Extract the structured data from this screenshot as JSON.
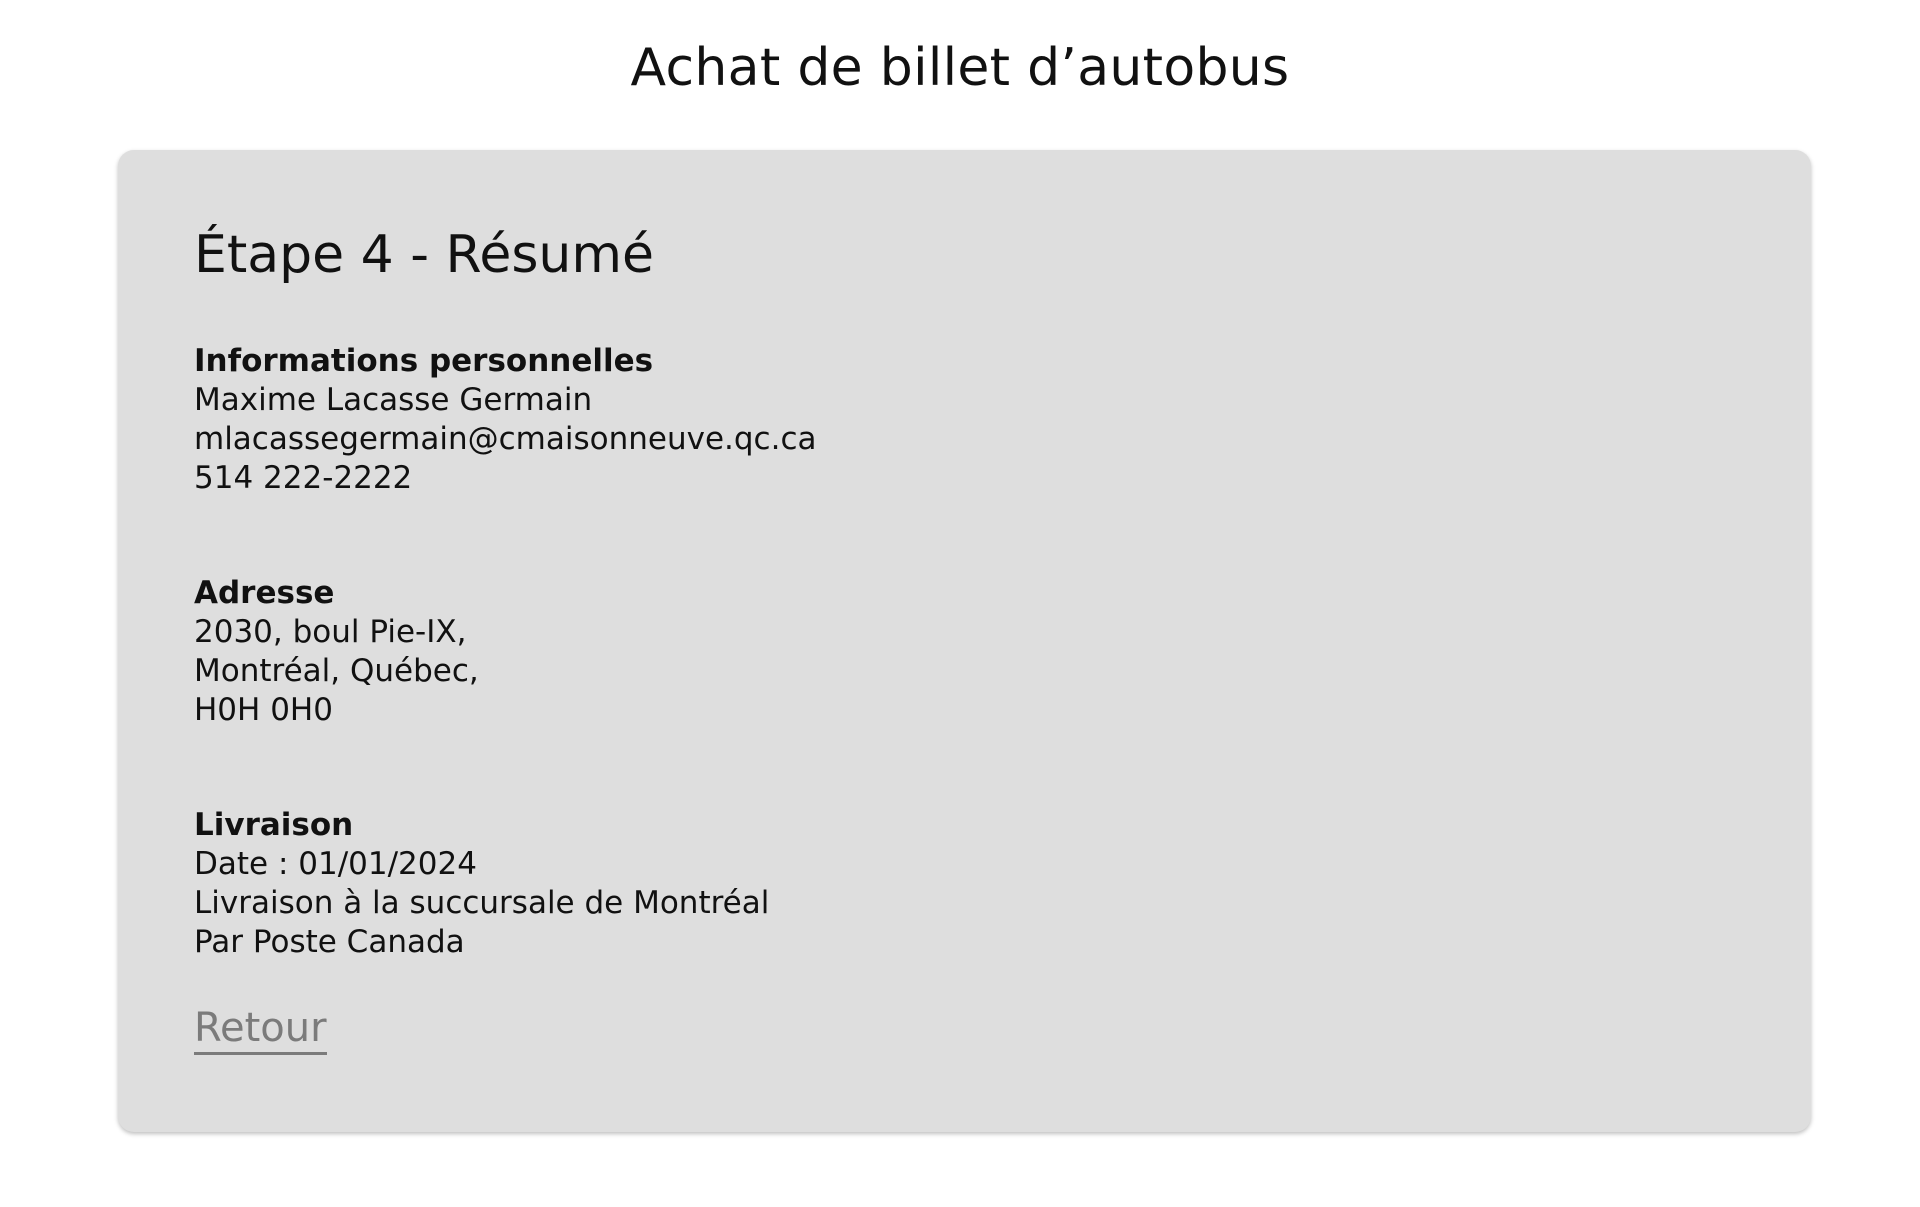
{
  "page": {
    "title": "Achat de billet d’autobus"
  },
  "card": {
    "step_title": "Étape 4 - Résumé",
    "sections": [
      {
        "heading": "Informations personnelles",
        "lines": [
          "Maxime Lacasse Germain",
          "mlacassegermain@cmaisonneuve.qc.ca",
          "514 222-2222"
        ]
      },
      {
        "heading": "Adresse",
        "lines": [
          "2030, boul Pie-IX,",
          "Montréal, Québec,",
          "H0H 0H0"
        ]
      },
      {
        "heading": "Livraison",
        "lines": [
          "Date : 01/01/2024",
          "Livraison à la succursale de Montréal",
          "Par Poste Canada"
        ]
      }
    ],
    "back_label": "Retour"
  },
  "colors": {
    "card_background": "#dedede",
    "link_gray": "#7b7b7b",
    "text": "#111111"
  }
}
